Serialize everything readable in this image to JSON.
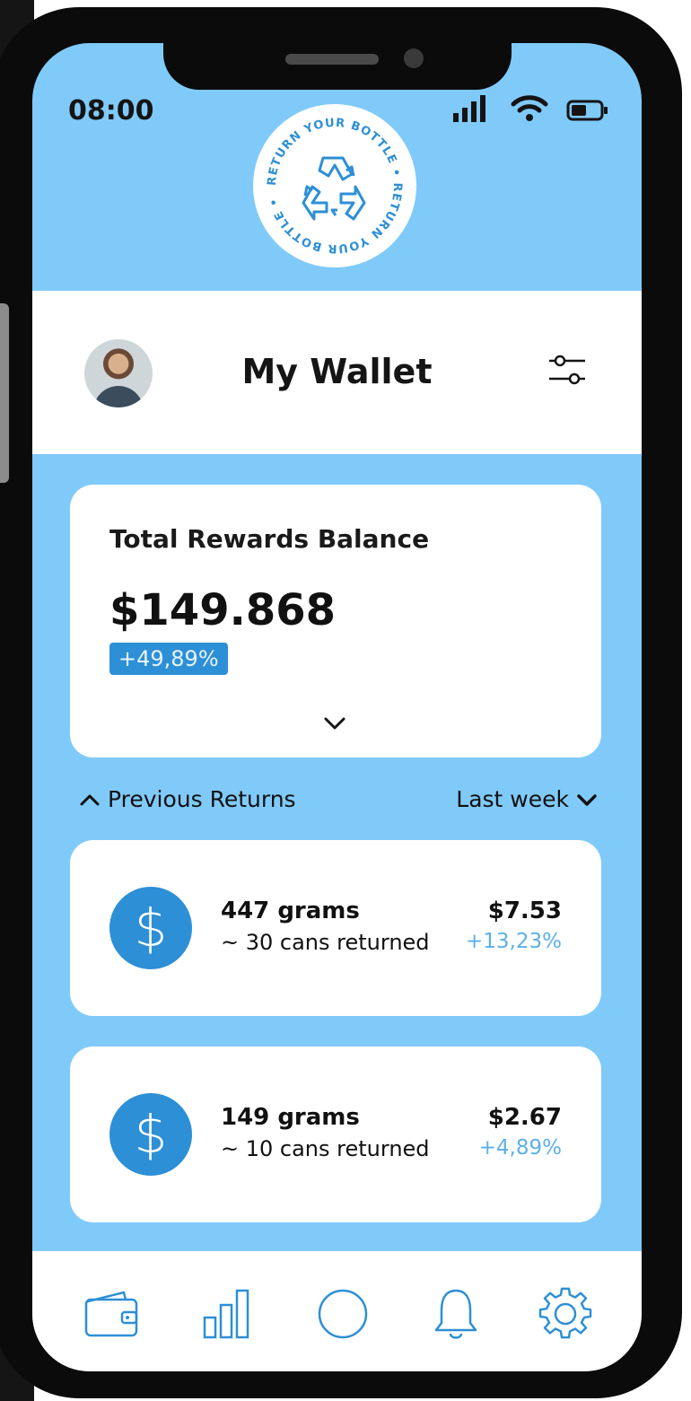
{
  "status_bar": {
    "time": "08:00"
  },
  "logo": {
    "ring_text": "RETURN YOUR BOTTLE • RETURN YOUR BOTTLE •"
  },
  "header": {
    "title": "My Wallet"
  },
  "balance": {
    "label": "Total Rewards Balance",
    "amount": "$149.868",
    "change": "+49,89%"
  },
  "section": {
    "title": "Previous Returns",
    "filter": "Last week"
  },
  "returns": [
    {
      "weight": "447 grams",
      "cans": "~ 30 cans returned",
      "amount": "$7.53",
      "change": "+13,23%"
    },
    {
      "weight": "149 grams",
      "cans": "~ 10 cans returned",
      "amount": "$2.67",
      "change": "+4,89%"
    }
  ],
  "icons": {
    "accent": "#2d8fd6",
    "light_blue": "#80cafa",
    "nav": [
      "wallet-icon",
      "chart-icon",
      "compass-icon",
      "bell-icon",
      "gear-icon"
    ]
  }
}
